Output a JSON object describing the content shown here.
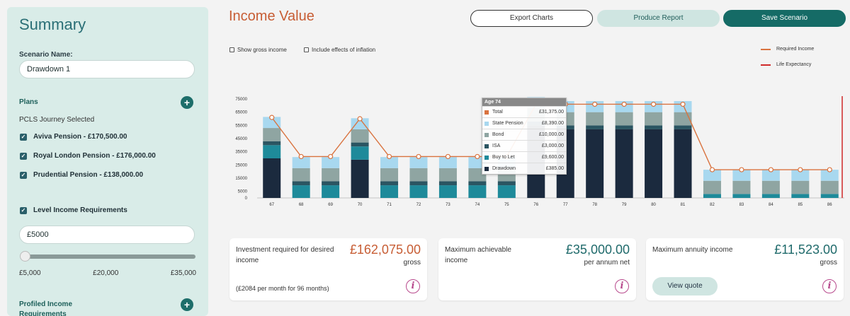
{
  "sidebar": {
    "title": "Summary",
    "scenario_label": "Scenario Name:",
    "scenario_value": "Drawdown 1",
    "plans_label": "Plans",
    "journey": "PCLS Journey Selected",
    "plans": [
      "Aviva Pension - £170,500.00",
      "Royal London Pension - £176,000.00",
      "Prudential Pension - £138,000.00"
    ],
    "level_income": "Level Income Requirements",
    "income_value": "£5000",
    "slider_ticks": [
      "£5,000",
      "£20,000",
      "£35,000"
    ],
    "slider_value": 0,
    "profiled": "Profiled Income Requirements"
  },
  "main": {
    "title": "Income Value",
    "buttons": {
      "export": "Export Charts",
      "report": "Produce Report",
      "save": "Save Scenario"
    },
    "options": [
      "Show gross income",
      "Include effects of inflation"
    ],
    "legend": [
      {
        "label": "Required Income",
        "color": "#d9733f"
      },
      {
        "label": "Life Expectancy",
        "color": "#d02a2a"
      }
    ]
  },
  "tooltip": {
    "title": "Age 74",
    "rows": [
      {
        "name": "Total",
        "value": "£31,375.00",
        "color": "#d9733f"
      },
      {
        "name": "State Pension",
        "value": "£8,390.00",
        "color": "#a8d8ef"
      },
      {
        "name": "Bond",
        "value": "£10,000.00",
        "color": "#8fa5a2"
      },
      {
        "name": "ISA",
        "value": "£3,000.00",
        "color": "#2b5562"
      },
      {
        "name": "Buy to Let",
        "value": "£9,600.00",
        "color": "#1e8a9a"
      },
      {
        "name": "Drawdown",
        "value": "£385.00",
        "color": "#1b2a3e"
      }
    ]
  },
  "cards": [
    {
      "label": "Investment required for desired income",
      "value": "£162,075.00",
      "sub": "gross",
      "note": "(£2084 per month for 96 months)",
      "value_color": "#c75d34"
    },
    {
      "label": "Maximum achievable income",
      "value": "£35,000.00",
      "sub": "per annum net",
      "note": "",
      "value_color": "#1f6a6b"
    },
    {
      "label": "Maximum annuity income",
      "value": "£11,523.00",
      "sub": "gross",
      "note": "",
      "value_color": "#1f6a6b",
      "button": "View quote"
    }
  ],
  "chart_data": {
    "type": "bar",
    "categories": [
      "67",
      "68",
      "69",
      "70",
      "71",
      "72",
      "73",
      "74",
      "75",
      "76",
      "77",
      "78",
      "79",
      "80",
      "81",
      "82",
      "83",
      "84",
      "85",
      "86"
    ],
    "ylim": [
      0,
      75000
    ],
    "yticks": [
      "75000",
      "65000",
      "55000",
      "45000",
      "35000",
      "25000",
      "15000",
      "5000",
      "0"
    ],
    "series": [
      {
        "name": "Drawdown",
        "color": "#1b2a3e",
        "values": [
          30000,
          0,
          0,
          29000,
          0,
          0,
          0,
          0,
          0,
          55000,
          52000,
          52000,
          52000,
          52000,
          52000,
          0,
          0,
          0,
          0,
          0
        ]
      },
      {
        "name": "Buy to Let",
        "color": "#1e8a9a",
        "values": [
          10000,
          9600,
          9600,
          10000,
          9600,
          9600,
          9600,
          9600,
          9600,
          0,
          0,
          0,
          0,
          0,
          0,
          3000,
          3000,
          3000,
          3000,
          3000
        ]
      },
      {
        "name": "ISA",
        "color": "#2b5562",
        "values": [
          3000,
          3000,
          3000,
          3000,
          3000,
          3000,
          3000,
          3000,
          3000,
          3000,
          3000,
          3000,
          3000,
          3000,
          3000,
          0,
          0,
          0,
          0,
          0
        ]
      },
      {
        "name": "Bond",
        "color": "#8fa5a2",
        "values": [
          10000,
          10000,
          10000,
          10000,
          10000,
          10000,
          10000,
          10000,
          10000,
          10000,
          10000,
          10000,
          10000,
          10000,
          10000,
          10000,
          10000,
          10000,
          10000,
          10000
        ]
      },
      {
        "name": "State Pension",
        "color": "#a8d8ef",
        "values": [
          8390,
          8390,
          8390,
          8390,
          8390,
          8390,
          8390,
          8390,
          8390,
          8390,
          8390,
          8390,
          8390,
          8390,
          8390,
          8390,
          8390,
          8390,
          8390,
          8390
        ]
      }
    ],
    "required_income": [
      61000,
      31375,
      31375,
      60000,
      31375,
      31375,
      31375,
      31375,
      31375,
      71000,
      71000,
      71000,
      71000,
      71000,
      71000,
      21390,
      21390,
      21390,
      21390,
      21390
    ]
  }
}
